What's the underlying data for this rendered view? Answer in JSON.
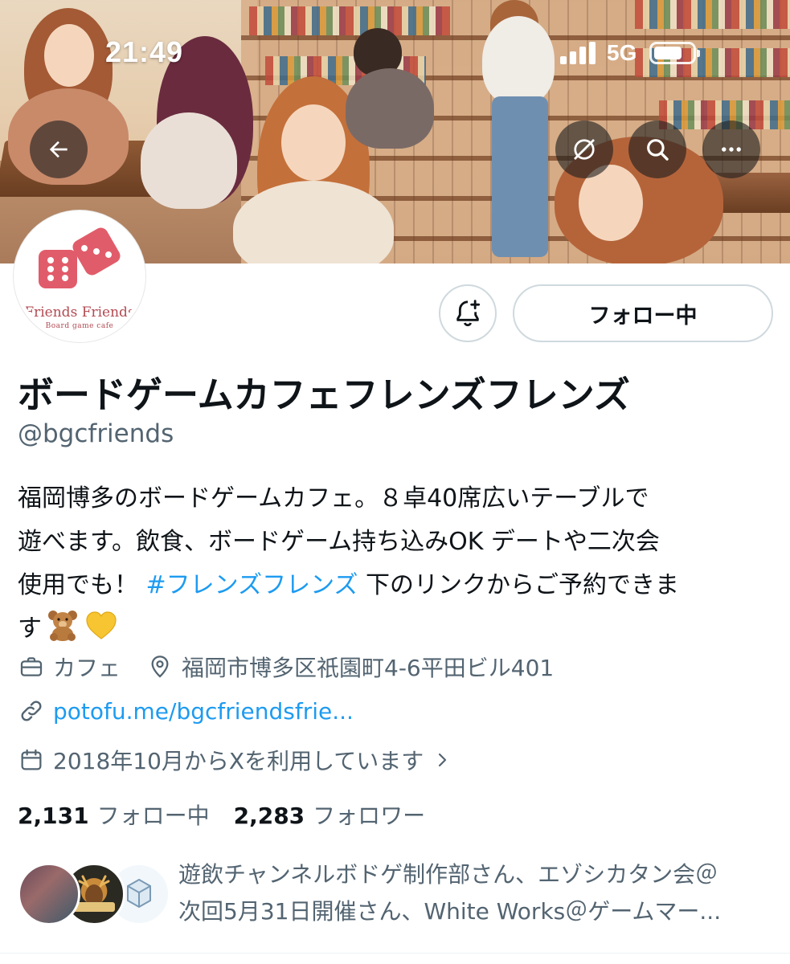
{
  "status_bar": {
    "time": "21:49",
    "network": "5G",
    "signal_icon": "cellular-signal-icon",
    "battery_icon": "battery-icon"
  },
  "header": {
    "back_icon": "arrow-left-icon",
    "mute_icon": "slashed-circle-icon",
    "search_icon": "search-icon",
    "more_icon": "more-horizontal-icon"
  },
  "profile": {
    "avatar": {
      "logo_text": "Friends Friends",
      "logo_subtitle": "Board game cafe",
      "logo_color": "#e15c6a"
    },
    "notify_icon": "bell-plus-icon",
    "follow_button_label": "フォロー中",
    "display_name": "ボードゲームカフェフレンズフレンズ",
    "handle": "@bgcfriends",
    "bio": {
      "line1": "福岡博多のボードゲームカフェ。８卓40席広いテーブルで",
      "line2": "遊べます。飲食、ボードゲーム持ち込みOK デートや二次会",
      "line3_prefix": "使用でも！ ",
      "hashtag": "#フレンズフレンズ",
      "line3_suffix": " 下のリンクからご予約できま",
      "line4": "す"
    },
    "category": "カフェ",
    "location": "福岡市博多区祇園町4-6平田ビル401",
    "link": "potofu.me/bgcfriendsfrie...",
    "joined": "2018年10月からXを利用しています",
    "following_count": "2,131",
    "following_label": "フォロー中",
    "followers_count": "2,283",
    "followers_label": "フォロワー",
    "followers_you_know": {
      "line1": "遊飲チャンネルボドゲ制作部さん、エゾシカタン会＠",
      "line2": "次回5月31日開催さん、White Works＠ゲームマー..."
    }
  },
  "colors": {
    "link": "#1d9bf0",
    "secondary_text": "#536471",
    "primary_text": "#0f1419",
    "border": "#cfd9de"
  }
}
